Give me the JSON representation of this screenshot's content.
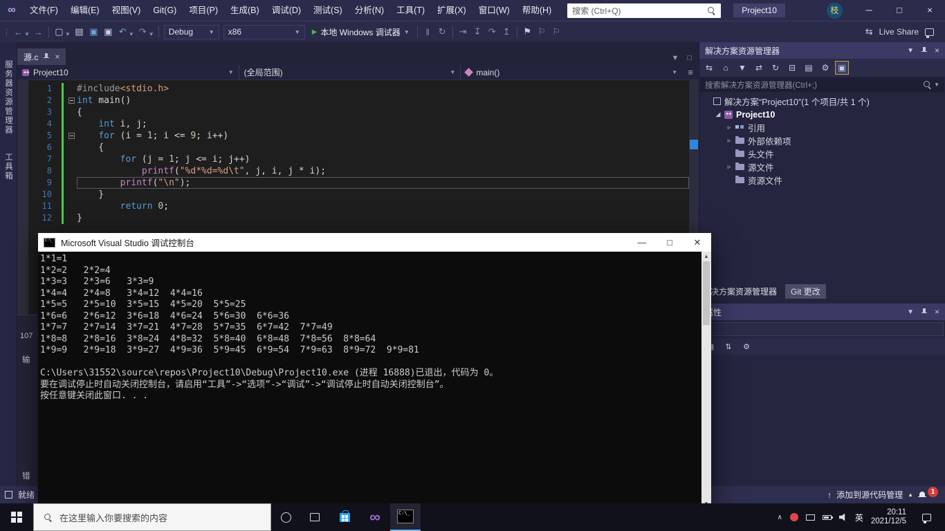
{
  "title_bar": {
    "menus": [
      "文件(F)",
      "编辑(E)",
      "视图(V)",
      "Git(G)",
      "项目(P)",
      "生成(B)",
      "调试(D)",
      "测试(S)",
      "分析(N)",
      "工具(T)",
      "扩展(X)",
      "窗口(W)",
      "帮助(H)"
    ],
    "search_placeholder": "搜索 (Ctrl+Q)",
    "project_name": "Project10",
    "avatar_text": "枝",
    "minimize": "─",
    "maximize": "□",
    "close": "×"
  },
  "toolbar": {
    "groups": [
      [
        {
          "name": "navigate-back-icon",
          "glyph": "←",
          "color": "#6FA8DC",
          "caret": true
        },
        {
          "name": "navigate-forward-icon",
          "glyph": "→",
          "color": "#8A8FA8"
        }
      ],
      [
        {
          "name": "new-project-icon",
          "glyph": "▢",
          "color": "#C8CCE0",
          "caret": true
        },
        {
          "name": "open-file-icon",
          "glyph": "▤",
          "color": "#C8CCE0"
        },
        {
          "name": "save-icon",
          "glyph": "▣",
          "color": "#6FA8DC"
        },
        {
          "name": "save-all-icon",
          "glyph": "▣",
          "color": "#C8CCE0"
        },
        {
          "name": "undo-icon",
          "glyph": "↶",
          "color": "#6FA8DC",
          "caret": true
        },
        {
          "name": "redo-icon",
          "glyph": "↷",
          "color": "#8A8FA8",
          "caret": true
        }
      ],
      [
        {
          "name": "breakpoints-icon",
          "glyph": "‖",
          "color": "#8A8FA8"
        },
        {
          "name": "hot-reload-icon",
          "glyph": "↻",
          "color": "#8A8FA8"
        }
      ],
      [
        {
          "name": "show-next-statement-icon",
          "glyph": "⇥",
          "color": "#8A8FA8"
        },
        {
          "name": "step-into-icon",
          "glyph": "↧",
          "color": "#8A8FA8"
        },
        {
          "name": "step-over-icon",
          "glyph": "↷",
          "color": "#8A8FA8"
        },
        {
          "name": "step-out-icon",
          "glyph": "↥",
          "color": "#8A8FA8"
        }
      ],
      [
        {
          "name": "bookmark-icon",
          "glyph": "⚑",
          "color": "#C8CCE0"
        },
        {
          "name": "previous-bookmark-icon",
          "glyph": "⚐",
          "color": "#8A8FA8"
        },
        {
          "name": "next-bookmark-icon",
          "glyph": "⚐",
          "color": "#8A8FA8"
        }
      ]
    ],
    "config": "Debug",
    "platform": "x86",
    "run_label": "本地 Windows 调试器",
    "live_share": "Live Share"
  },
  "left_strip": {
    "tabs": [
      "服务器资源管理器",
      "工具箱"
    ]
  },
  "editor": {
    "tab_name": "源.c",
    "nav": {
      "project": "Project10",
      "scope": "(全局范围)",
      "member": "main()"
    },
    "code": {
      "lines": [
        {
          "n": 1,
          "segs": [
            [
              "pp",
              "#include"
            ],
            [
              "str",
              "<stdio.h>"
            ]
          ]
        },
        {
          "n": 2,
          "segs": [
            [
              "kw",
              "int"
            ],
            [
              "pl",
              " main()"
            ]
          ],
          "fold": true
        },
        {
          "n": 3,
          "segs": [
            [
              "pl",
              "{"
            ]
          ]
        },
        {
          "n": 4,
          "segs": [
            [
              "pl",
              "    "
            ],
            [
              "kw",
              "int"
            ],
            [
              "pl",
              " i, j;"
            ]
          ]
        },
        {
          "n": 5,
          "segs": [
            [
              "pl",
              "    "
            ],
            [
              "kw",
              "for"
            ],
            [
              "pl",
              " (i = "
            ],
            [
              "num",
              "1"
            ],
            [
              "pl",
              "; i <= "
            ],
            [
              "num",
              "9"
            ],
            [
              "pl",
              "; i++)"
            ]
          ],
          "fold": true
        },
        {
          "n": 6,
          "segs": [
            [
              "pl",
              "    {"
            ]
          ]
        },
        {
          "n": 7,
          "segs": [
            [
              "pl",
              "        "
            ],
            [
              "kw",
              "for"
            ],
            [
              "pl",
              " (j = "
            ],
            [
              "num",
              "1"
            ],
            [
              "pl",
              "; j <= i; j++)"
            ]
          ]
        },
        {
          "n": 8,
          "segs": [
            [
              "pl",
              "            "
            ],
            [
              "fn",
              "printf"
            ],
            [
              "pl",
              "("
            ],
            [
              "str",
              "\"%d*%d=%d\\t\""
            ],
            [
              "pl",
              ", j, i, j * i);"
            ]
          ]
        },
        {
          "n": 9,
          "segs": [
            [
              "pl",
              "        "
            ],
            [
              "fn",
              "printf"
            ],
            [
              "pl",
              "("
            ],
            [
              "str",
              "\"\\n\""
            ],
            [
              "pl",
              ");"
            ]
          ],
          "caret": true
        },
        {
          "n": 10,
          "segs": [
            [
              "pl",
              "    }"
            ]
          ]
        },
        {
          "n": 11,
          "segs": [
            [
              "pl",
              "        "
            ],
            [
              "kw",
              "return"
            ],
            [
              "pl",
              " "
            ],
            [
              "num",
              "0"
            ],
            [
              "pl",
              ";"
            ]
          ]
        },
        {
          "n": 12,
          "segs": [
            [
              "pl",
              "}"
            ]
          ]
        }
      ]
    }
  },
  "output_fragments": [
    "107",
    "输",
    "错"
  ],
  "console": {
    "title": "Microsoft Visual Studio 调试控制台",
    "minimize": "—",
    "maximize": "□",
    "close": "✕",
    "lines": [
      "1*1=1",
      "1*2=2   2*2=4",
      "1*3=3   2*3=6   3*3=9",
      "1*4=4   2*4=8   3*4=12  4*4=16",
      "1*5=5   2*5=10  3*5=15  4*5=20  5*5=25",
      "1*6=6   2*6=12  3*6=18  4*6=24  5*6=30  6*6=36",
      "1*7=7   2*7=14  3*7=21  4*7=28  5*7=35  6*7=42  7*7=49",
      "1*8=8   2*8=16  3*8=24  4*8=32  5*8=40  6*8=48  7*8=56  8*8=64",
      "1*9=9   2*9=18  3*9=27  4*9=36  5*9=45  6*9=54  7*9=63  8*9=72  9*9=81",
      "",
      "C:\\Users\\31552\\source\\repos\\Project10\\Debug\\Project10.exe (进程 16888)已退出，代码为 0。",
      "要在调试停止时自动关闭控制台，请启用“工具”->“选项”->“调试”->“调试停止时自动关闭控制台”。",
      "按任意键关闭此窗口. . ."
    ]
  },
  "solution_explorer": {
    "title": "解决方案资源管理器",
    "toolbar_icons": [
      {
        "name": "switch-views-icon",
        "glyph": "⇆"
      },
      {
        "name": "home-icon",
        "glyph": "⌂"
      },
      {
        "name": "filter-icon",
        "glyph": "▼"
      },
      {
        "name": "sync-with-active-document-icon",
        "glyph": "⇄"
      },
      {
        "name": "refresh-icon",
        "glyph": "↻"
      },
      {
        "name": "collapse-all-icon",
        "glyph": "⊟"
      },
      {
        "name": "show-all-files-icon",
        "glyph": "▤"
      },
      {
        "name": "properties-icon",
        "glyph": "⚙"
      },
      {
        "name": "preview-selected-items-icon",
        "glyph": "▣",
        "active": true
      }
    ],
    "search_placeholder": "搜索解决方案资源管理器(Ctrl+;)",
    "tree": [
      {
        "label": "解决方案“Project10”(1 个项目/共 1 个)",
        "icon": "solution",
        "indent": 0,
        "arrow": ""
      },
      {
        "label": "Project10",
        "icon": "cpp",
        "indent": 1,
        "arrow": "expanded",
        "bold": true
      },
      {
        "label": "引用",
        "icon": "refs",
        "indent": 2,
        "arrow": "collapsed"
      },
      {
        "label": "外部依赖项",
        "icon": "folder",
        "indent": 2,
        "arrow": "collapsed"
      },
      {
        "label": "头文件",
        "icon": "folder",
        "indent": 2,
        "arrow": ""
      },
      {
        "label": "源文件",
        "icon": "folder",
        "indent": 2,
        "arrow": "collapsed"
      },
      {
        "label": "资源文件",
        "icon": "folder",
        "indent": 2,
        "arrow": ""
      }
    ],
    "bottom_tabs": [
      "解决方案资源管理器",
      "Git 更改"
    ]
  },
  "properties_panel": {
    "title": "属性",
    "selector_value": "",
    "toolbar_icons": [
      {
        "name": "categorized-icon",
        "glyph": "▦"
      },
      {
        "name": "alphabetical-icon",
        "glyph": "⇅"
      },
      {
        "name": "property-pages-icon",
        "glyph": "⚙"
      }
    ]
  },
  "status_bar": {
    "left": "就绪",
    "source_control": "添加到源代码管理",
    "notification_count": "1"
  },
  "taskbar": {
    "search_placeholder": "在这里输入你要搜索的内容",
    "ime": "英",
    "time": "20:11",
    "date": "2021/12/5"
  },
  "colors": {
    "accent_blue": "#007ACC",
    "keyword": "#569CD6",
    "string": "#D69D85",
    "number": "#B5CEA8",
    "function": "#C586C0",
    "line_number": "#3B79C2",
    "change_bar": "#4EC94E"
  }
}
